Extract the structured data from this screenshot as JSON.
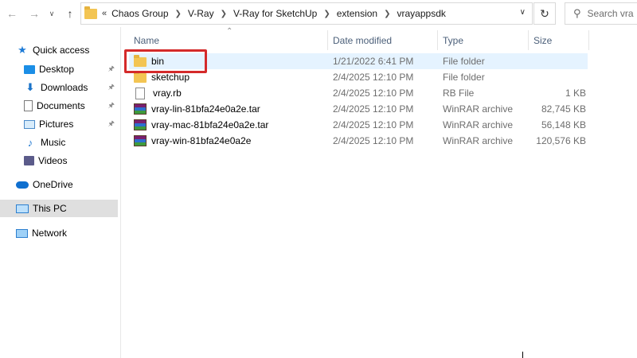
{
  "window": {
    "search_placeholder": "Search vra"
  },
  "address": {
    "overflow": "«",
    "crumbs": [
      "Chaos Group",
      "V-Ray",
      "V-Ray for SketchUp",
      "extension",
      "vrayappsdk"
    ]
  },
  "sidebar": {
    "quick_access": "Quick access",
    "items": [
      {
        "label": "Desktop",
        "icon": "desktop-icon",
        "pinned": true
      },
      {
        "label": "Downloads",
        "icon": "download-icon",
        "pinned": true
      },
      {
        "label": "Documents",
        "icon": "document-icon",
        "pinned": true
      },
      {
        "label": "Pictures",
        "icon": "pictures-icon",
        "pinned": true
      },
      {
        "label": "Music",
        "icon": "music-icon",
        "pinned": false
      },
      {
        "label": "Videos",
        "icon": "videos-icon",
        "pinned": false
      }
    ],
    "onedrive": "OneDrive",
    "this_pc": "This PC",
    "network": "Network"
  },
  "columns": {
    "name": "Name",
    "date": "Date modified",
    "type": "Type",
    "size": "Size"
  },
  "files": [
    {
      "name": "bin",
      "date": "1/21/2022 6:41 PM",
      "type": "File folder",
      "size": "",
      "icon": "folder-icon",
      "selected": true
    },
    {
      "name": "sketchup",
      "date": "2/4/2025 12:10 PM",
      "type": "File folder",
      "size": "",
      "icon": "folder-icon"
    },
    {
      "name": "vray.rb",
      "date": "2/4/2025 12:10 PM",
      "type": "RB File",
      "size": "1 KB",
      "icon": "file-icon"
    },
    {
      "name": "vray-lin-81bfa24e0a2e.tar",
      "date": "2/4/2025 12:10 PM",
      "type": "WinRAR archive",
      "size": "82,745 KB",
      "icon": "archive-icon"
    },
    {
      "name": "vray-mac-81bfa24e0a2e.tar",
      "date": "2/4/2025 12:10 PM",
      "type": "WinRAR archive",
      "size": "56,148 KB",
      "icon": "archive-icon"
    },
    {
      "name": "vray-win-81bfa24e0a2e",
      "date": "2/4/2025 12:10 PM",
      "type": "WinRAR archive",
      "size": "120,576 KB",
      "icon": "archive-icon"
    }
  ],
  "colors": {
    "selection": "#e5f3ff",
    "highlight_box": "#d42a2a",
    "nav_selected": "#dfdfdf"
  }
}
